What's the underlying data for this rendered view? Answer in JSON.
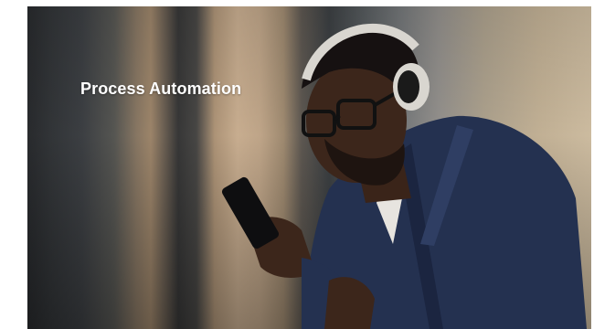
{
  "hero": {
    "title": "Process Automation"
  },
  "icons": {
    "background": "photo-person-with-headphones-and-phone"
  },
  "colors": {
    "title_text": "#ffffff",
    "suit": "#243150",
    "headphone": "#d9d6d0"
  }
}
